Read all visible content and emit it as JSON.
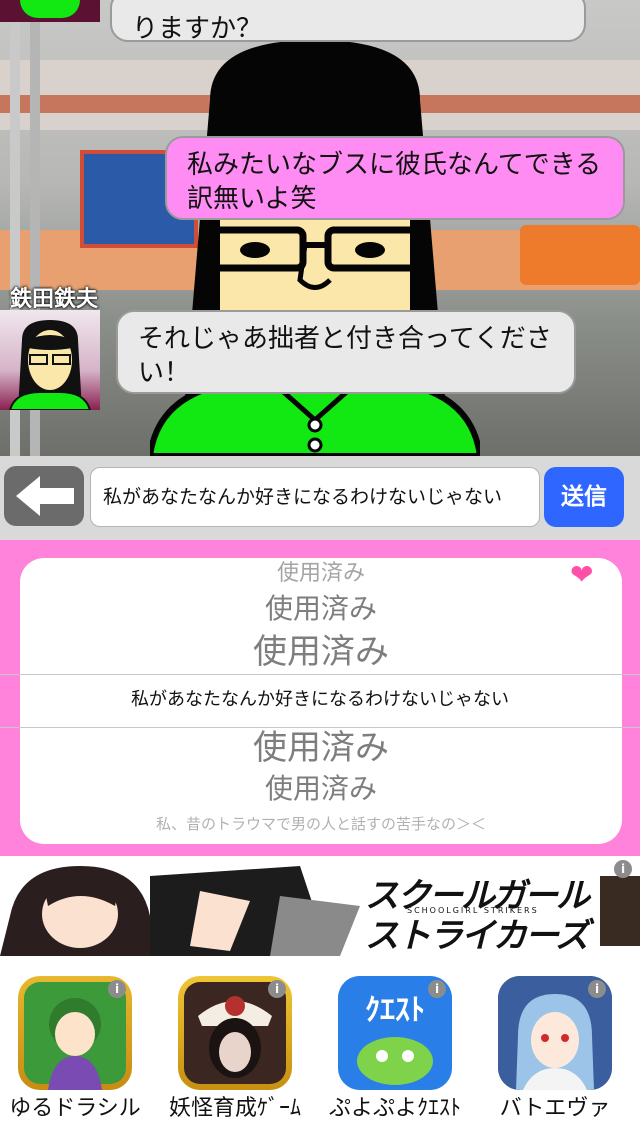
{
  "chat": {
    "messages": [
      {
        "type": "received",
        "text": "りますか？"
      },
      {
        "type": "sent",
        "text": "私みたいなブスに彼氏なんてできる訳無いよ笑"
      },
      {
        "type": "received",
        "text": "それじゃあ拙者と付き合ってください！",
        "sender": "鉄田鉄夫"
      }
    ]
  },
  "input": {
    "value": "私があなたなんか好きになるわけないじゃない",
    "send_label": "送信"
  },
  "picker": {
    "items_above": [
      "使用済み",
      "使用済み",
      "使用済み"
    ],
    "selected": "私があなたなんか好きになるわけないじゃない",
    "items_below": [
      "使用済み",
      "使用済み",
      "私、昔のトラウマで男の人と話すの苦手なの＞＜"
    ]
  },
  "ad_banner": {
    "title_line1": "スクールガール",
    "subtitle": "SCHOOLGIRL STRIKERS",
    "title_line2": "ストライカーズ"
  },
  "apps": [
    {
      "label": "ゆるドラシル",
      "color": "#3c9a3a"
    },
    {
      "label": "妖怪育成ｹﾞｰﾑ",
      "color": "#3b2622"
    },
    {
      "label": "ぷよぷよｸｴｽﾄ",
      "color": "#2a7ee8"
    },
    {
      "label": "バトエヴァ",
      "color": "#3b5e9e"
    }
  ],
  "colors": {
    "accent_pink": "#ff82db",
    "send_blue": "#2f66ff",
    "sent_bubble": "#ff8cf3"
  }
}
